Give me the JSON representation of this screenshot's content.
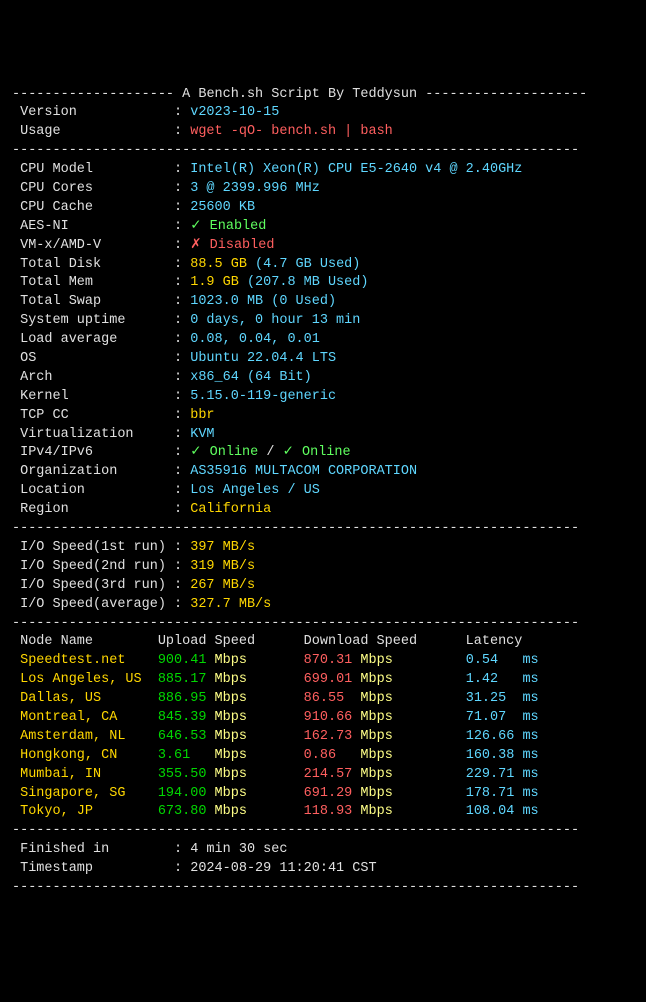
{
  "header": {
    "title": "A Bench.sh Script By Teddysun",
    "version_label": "Version",
    "version_value": "v2023-10-15",
    "usage_label": "Usage",
    "usage_value": "wget -qO- bench.sh | bash"
  },
  "sysinfo": {
    "cpu_model_label": "CPU Model",
    "cpu_model_value": "Intel(R) Xeon(R) CPU E5-2640 v4 @ 2.40GHz",
    "cpu_cores_label": "CPU Cores",
    "cpu_cores_value": "3 @ 2399.996 MHz",
    "cpu_cache_label": "CPU Cache",
    "cpu_cache_value": "25600 KB",
    "aes_label": "AES-NI",
    "aes_value": "✓ Enabled",
    "vmx_label": "VM-x/AMD-V",
    "vmx_value": "✗ Disabled",
    "disk_label": "Total Disk",
    "disk_value": "88.5 GB",
    "disk_used": "(4.7 GB Used)",
    "mem_label": "Total Mem",
    "mem_value": "1.9 GB",
    "mem_used": "(207.8 MB Used)",
    "swap_label": "Total Swap",
    "swap_value": "1023.0 MB",
    "swap_used": "(0 Used)",
    "uptime_label": "System uptime",
    "uptime_value": "0 days, 0 hour 13 min",
    "load_label": "Load average",
    "load_value": "0.08, 0.04, 0.01",
    "os_label": "OS",
    "os_value": "Ubuntu 22.04.4 LTS",
    "arch_label": "Arch",
    "arch_value": "x86_64 (64 Bit)",
    "kernel_label": "Kernel",
    "kernel_value": "5.15.0-119-generic",
    "tcp_label": "TCP CC",
    "tcp_value": "bbr",
    "virt_label": "Virtualization",
    "virt_value": "KVM",
    "ipv_label": "IPv4/IPv6",
    "ipv4_value": "✓ Online",
    "ipv_sep": " / ",
    "ipv6_value": "✓ Online",
    "org_label": "Organization",
    "org_value": "AS35916 MULTACOM CORPORATION",
    "loc_label": "Location",
    "loc_value": "Los Angeles / US",
    "region_label": "Region",
    "region_value": "California"
  },
  "io": {
    "run1_label": "I/O Speed(1st run)",
    "run1_value": "397 MB/s",
    "run2_label": "I/O Speed(2nd run)",
    "run2_value": "319 MB/s",
    "run3_label": "I/O Speed(3rd run)",
    "run3_value": "267 MB/s",
    "avg_label": "I/O Speed(average)",
    "avg_value": "327.7 MB/s"
  },
  "speedtest": {
    "header_node": "Node Name",
    "header_upload": "Upload Speed",
    "header_download": "Download Speed",
    "header_latency": "Latency",
    "rows": [
      {
        "node": "Speedtest.net",
        "up": "900.41",
        "down": "870.31",
        "lat": "0.54"
      },
      {
        "node": "Los Angeles, US",
        "up": "885.17",
        "down": "699.01",
        "lat": "1.42"
      },
      {
        "node": "Dallas, US",
        "up": "886.95",
        "down": "86.55",
        "lat": "31.25"
      },
      {
        "node": "Montreal, CA",
        "up": "845.39",
        "down": "910.66",
        "lat": "71.07"
      },
      {
        "node": "Amsterdam, NL",
        "up": "646.53",
        "down": "162.73",
        "lat": "126.66"
      },
      {
        "node": "Hongkong, CN",
        "up": "3.61",
        "down": "0.86",
        "lat": "160.38"
      },
      {
        "node": "Mumbai, IN",
        "up": "355.50",
        "down": "214.57",
        "lat": "229.71"
      },
      {
        "node": "Singapore, SG",
        "up": "194.00",
        "down": "691.29",
        "lat": "178.71"
      },
      {
        "node": "Tokyo, JP",
        "up": "673.80",
        "down": "118.93",
        "lat": "108.04"
      }
    ],
    "mbps": "Mbps",
    "ms": "ms"
  },
  "footer": {
    "finished_label": "Finished in",
    "finished_value": "4 min 30 sec",
    "ts_label": "Timestamp",
    "ts_value": "2024-08-29 11:20:41 CST"
  },
  "divider_long": "----------------------------------------------------------------------",
  "divider_header_pre": "-------------------- ",
  "divider_header_post": " --------------------"
}
